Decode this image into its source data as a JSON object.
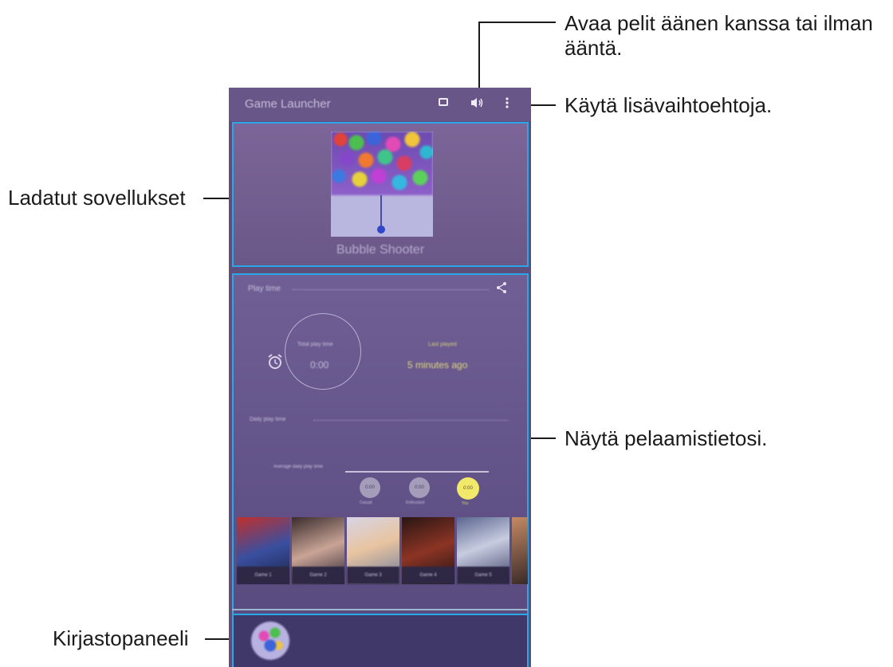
{
  "annotations": {
    "sound": "Avaa pelit äänen kanssa tai ilman ääntä.",
    "sound_line1": "Avaa pelit äänen kanssa tai ilman",
    "sound_line2": "ääntä.",
    "more_options": "Käytä lisävaihtoehtoja.",
    "downloaded_apps": "Ladatut sovellukset",
    "play_info": "Näytä pelaamistietosi.",
    "library_panel": "Kirjastopaneeli"
  },
  "topbar": {
    "title": "Game Launcher",
    "icons": [
      "screen-icon",
      "sound-icon",
      "more-options-icon"
    ]
  },
  "apps_panel": {
    "game_name": "Bubble Shooter"
  },
  "stats_panel": {
    "section_title": "Play time",
    "share_icon": "share-icon",
    "clock_icon": "alarm-clock-icon",
    "total_label": "Total play time",
    "total_value": "0:00",
    "last_played_label": "Last played",
    "last_played_value": "5 minutes ago",
    "daily_label": "Daily play time",
    "avg_label": "Average daily play time",
    "compare": [
      {
        "value": "0:00",
        "label": "Casual"
      },
      {
        "value": "0:00",
        "label": "Enthusiast"
      },
      {
        "value": "0:00",
        "label": "You",
        "highlight": true
      }
    ],
    "thumbnails": [
      "Game 1",
      "Game 2",
      "Game 3",
      "Game 4",
      "Game 5"
    ]
  },
  "colors": {
    "accent": "#2aa7e8",
    "screen_bg": "#5d4e7c",
    "highlight": "#f2e86a"
  }
}
